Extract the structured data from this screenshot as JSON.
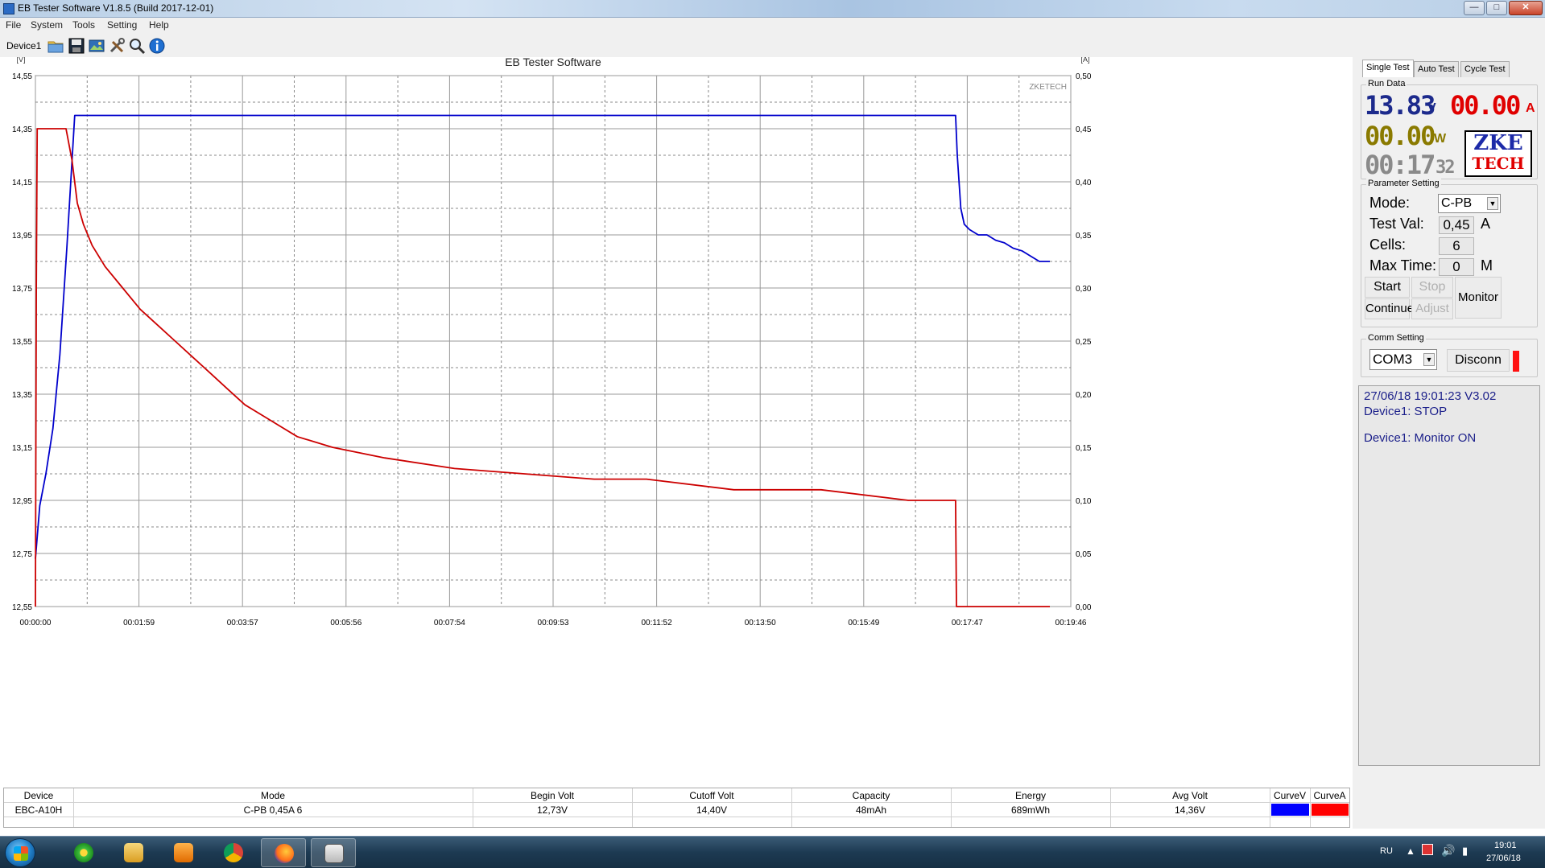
{
  "window": {
    "title": "EB Tester Software V1.8.5 (Build 2017-12-01)",
    "min": "—",
    "max": "□",
    "close": "✕"
  },
  "menu": [
    "File",
    "System",
    "Tools",
    "Setting",
    "Help"
  ],
  "toolbar": {
    "device": "Device1",
    "icons": [
      "folder-icon",
      "save-icon",
      "picture-icon",
      "tools-icon",
      "zoom-icon",
      "info-icon"
    ]
  },
  "chart_data": {
    "type": "line",
    "title": "EB Tester Software",
    "watermark": "ZKETECH",
    "left_axis_unit": "[V]",
    "right_axis_unit": "[A]",
    "ylim_left": [
      12.55,
      14.55
    ],
    "ylim_right": [
      0.0,
      0.5
    ],
    "xlim_seconds": [
      0,
      1186
    ],
    "y_ticks_left": [
      "14,55",
      "14,35",
      "14,15",
      "13,95",
      "13,75",
      "13,55",
      "13,35",
      "13,15",
      "12,95",
      "12,75",
      "12,55"
    ],
    "y_ticks_right": [
      "0,50",
      "0,45",
      "0,40",
      "0,35",
      "0,30",
      "0,25",
      "0,20",
      "0,15",
      "0,10",
      "0,05",
      "0,00"
    ],
    "x_ticks": [
      "00:00:00",
      "00:01:59",
      "00:03:57",
      "00:05:56",
      "00:07:54",
      "00:09:53",
      "00:11:52",
      "00:13:50",
      "00:15:49",
      "00:17:47",
      "00:19:46"
    ],
    "grid": true,
    "series": [
      {
        "axis": "left",
        "color": "#0000cc",
        "x": [
          0,
          5,
          12,
          20,
          28,
          36,
          45,
          60,
          105,
          300,
          600,
          900,
          1054,
          1056,
          1060,
          1064,
          1070,
          1080,
          1090,
          1100,
          1110,
          1120,
          1130,
          1140,
          1150,
          1162
        ],
        "values": [
          12.73,
          12.93,
          13.05,
          13.22,
          13.5,
          13.9,
          14.4,
          14.4,
          14.4,
          14.4,
          14.4,
          14.4,
          14.4,
          14.25,
          14.05,
          13.99,
          13.97,
          13.95,
          13.95,
          13.93,
          13.92,
          13.9,
          13.89,
          13.87,
          13.85,
          13.85
        ]
      },
      {
        "axis": "right",
        "color": "#cc0000",
        "x": [
          0,
          1,
          2,
          35,
          42,
          48,
          55,
          65,
          80,
          100,
          120,
          140,
          160,
          180,
          200,
          220,
          240,
          260,
          280,
          300,
          340,
          400,
          480,
          560,
          640,
          700,
          800,
          900,
          1000,
          1054,
          1055,
          1162
        ],
        "values": [
          0.0,
          0.3,
          0.45,
          0.45,
          0.42,
          0.38,
          0.36,
          0.34,
          0.32,
          0.3,
          0.28,
          0.265,
          0.25,
          0.235,
          0.22,
          0.205,
          0.19,
          0.18,
          0.17,
          0.16,
          0.15,
          0.14,
          0.13,
          0.125,
          0.12,
          0.12,
          0.11,
          0.11,
          0.1,
          0.1,
          0.0,
          0.0
        ]
      }
    ]
  },
  "panel": {
    "tabs": [
      "Single Test",
      "Auto Test",
      "Cycle Test"
    ],
    "run_data_title": "Run Data",
    "voltage": "13.83",
    "voltage_unit": "V",
    "current": "00.00",
    "current_unit": "A",
    "power": "00.00",
    "power_unit": "W",
    "time_main": "00:17",
    "time_sec": "32",
    "logo_line1": "ZKE",
    "logo_line2": "TECH",
    "param_title": "Parameter Setting",
    "mode_label": "Mode:",
    "mode_value": "C-PB",
    "testval_label": "Test Val:",
    "testval_value": "0,45",
    "testval_unit": "A",
    "cells_label": "Cells:",
    "cells_value": "6",
    "maxtime_label": "Max Time:",
    "maxtime_value": "0",
    "maxtime_unit": "M",
    "btn_start": "Start",
    "btn_stop": "Stop",
    "btn_monitor": "Monitor",
    "btn_continue": "Continue",
    "btn_adjust": "Adjust",
    "comm_title": "Comm Setting",
    "com_port": "COM3",
    "btn_disconn": "Disconn",
    "log": [
      "27/06/18 19:01:23  V3.02",
      "Device1: STOP",
      "Device1: Monitor ON"
    ]
  },
  "results": {
    "headers": [
      "Device",
      "Mode",
      "Begin Volt",
      "Cutoff Volt",
      "Capacity",
      "Energy",
      "Avg Volt",
      "CurveV",
      "CurveA"
    ],
    "row": [
      "EBC-A10H",
      "C-PB  0,45A  6",
      "12,73V",
      "14,40V",
      "48mAh",
      "689mWh",
      "14,36V"
    ],
    "curve_colors": [
      "#0000ff",
      "#ff0000"
    ]
  },
  "taskbar": {
    "apps": [
      "flower-app-icon",
      "explorer-icon",
      "media-player-icon",
      "chrome-icon",
      "firefox-icon",
      "eb-tester-icon"
    ],
    "lang": "RU",
    "time": "19:01",
    "date": "27/06/18"
  }
}
